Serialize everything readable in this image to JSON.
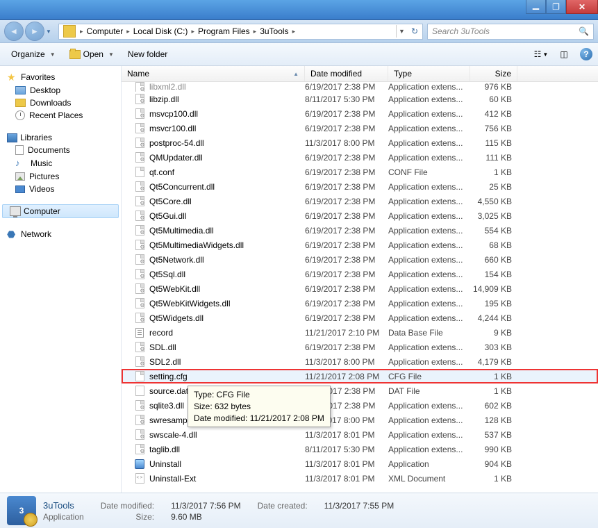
{
  "window": {
    "min": "_",
    "max": "❐",
    "close": "✕"
  },
  "breadcrumb": {
    "segments": [
      "Computer",
      "Local Disk (C:)",
      "Program Files",
      "3uTools"
    ]
  },
  "search": {
    "placeholder": "Search 3uTools"
  },
  "toolbar": {
    "organize": "Organize",
    "open": "Open",
    "newfolder": "New folder"
  },
  "columns": {
    "name": "Name",
    "date": "Date modified",
    "type": "Type",
    "size": "Size"
  },
  "sidebar": {
    "favorites": {
      "label": "Favorites",
      "items": [
        "Desktop",
        "Downloads",
        "Recent Places"
      ]
    },
    "libraries": {
      "label": "Libraries",
      "items": [
        "Documents",
        "Music",
        "Pictures",
        "Videos"
      ]
    },
    "computer": {
      "label": "Computer"
    },
    "network": {
      "label": "Network"
    }
  },
  "files": [
    {
      "name": "libxml2.dll",
      "date": "6/19/2017 2:38 PM",
      "type": "Application extens...",
      "size": "976 KB",
      "icon": "dll",
      "partial": true
    },
    {
      "name": "libzip.dll",
      "date": "8/11/2017 5:30 PM",
      "type": "Application extens...",
      "size": "60 KB",
      "icon": "dll"
    },
    {
      "name": "msvcp100.dll",
      "date": "6/19/2017 2:38 PM",
      "type": "Application extens...",
      "size": "412 KB",
      "icon": "dll"
    },
    {
      "name": "msvcr100.dll",
      "date": "6/19/2017 2:38 PM",
      "type": "Application extens...",
      "size": "756 KB",
      "icon": "dll"
    },
    {
      "name": "postproc-54.dll",
      "date": "11/3/2017 8:00 PM",
      "type": "Application extens...",
      "size": "115 KB",
      "icon": "dll"
    },
    {
      "name": "QMUpdater.dll",
      "date": "6/19/2017 2:38 PM",
      "type": "Application extens...",
      "size": "111 KB",
      "icon": "dll"
    },
    {
      "name": "qt.conf",
      "date": "6/19/2017 2:38 PM",
      "type": "CONF File",
      "size": "1 KB",
      "icon": "cfg"
    },
    {
      "name": "Qt5Concurrent.dll",
      "date": "6/19/2017 2:38 PM",
      "type": "Application extens...",
      "size": "25 KB",
      "icon": "dll"
    },
    {
      "name": "Qt5Core.dll",
      "date": "6/19/2017 2:38 PM",
      "type": "Application extens...",
      "size": "4,550 KB",
      "icon": "dll"
    },
    {
      "name": "Qt5Gui.dll",
      "date": "6/19/2017 2:38 PM",
      "type": "Application extens...",
      "size": "3,025 KB",
      "icon": "dll"
    },
    {
      "name": "Qt5Multimedia.dll",
      "date": "6/19/2017 2:38 PM",
      "type": "Application extens...",
      "size": "554 KB",
      "icon": "dll"
    },
    {
      "name": "Qt5MultimediaWidgets.dll",
      "date": "6/19/2017 2:38 PM",
      "type": "Application extens...",
      "size": "68 KB",
      "icon": "dll"
    },
    {
      "name": "Qt5Network.dll",
      "date": "6/19/2017 2:38 PM",
      "type": "Application extens...",
      "size": "660 KB",
      "icon": "dll"
    },
    {
      "name": "Qt5Sql.dll",
      "date": "6/19/2017 2:38 PM",
      "type": "Application extens...",
      "size": "154 KB",
      "icon": "dll"
    },
    {
      "name": "Qt5WebKit.dll",
      "date": "6/19/2017 2:38 PM",
      "type": "Application extens...",
      "size": "14,909 KB",
      "icon": "dll"
    },
    {
      "name": "Qt5WebKitWidgets.dll",
      "date": "6/19/2017 2:38 PM",
      "type": "Application extens...",
      "size": "195 KB",
      "icon": "dll"
    },
    {
      "name": "Qt5Widgets.dll",
      "date": "6/19/2017 2:38 PM",
      "type": "Application extens...",
      "size": "4,244 KB",
      "icon": "dll"
    },
    {
      "name": "record",
      "date": "11/21/2017 2:10 PM",
      "type": "Data Base File",
      "size": "9 KB",
      "icon": "db"
    },
    {
      "name": "SDL.dll",
      "date": "6/19/2017 2:38 PM",
      "type": "Application extens...",
      "size": "303 KB",
      "icon": "dll"
    },
    {
      "name": "SDL2.dll",
      "date": "11/3/2017 8:00 PM",
      "type": "Application extens...",
      "size": "4,179 KB",
      "icon": "dll"
    },
    {
      "name": "setting.cfg",
      "date": "11/21/2017 2:08 PM",
      "type": "CFG File",
      "size": "1 KB",
      "icon": "cfg",
      "highlight": true
    },
    {
      "name": "source.dat",
      "date": "6/19/2017 2:38 PM",
      "type": "DAT File",
      "size": "1 KB",
      "icon": "dat",
      "obscured_date": "9/2017 2:38 PM"
    },
    {
      "name": "sqlite3.dll",
      "date": "6/19/2017 2:38 PM",
      "type": "Application extens...",
      "size": "602 KB",
      "icon": "dll",
      "obscured_date": "9/2017 2:38 PM"
    },
    {
      "name": "swresample-2.dll",
      "date": "11/3/2017 8:00 PM",
      "type": "Application extens...",
      "size": "128 KB",
      "icon": "dll",
      "obscured_date": "3/2017 8:00 PM"
    },
    {
      "name": "swscale-4.dll",
      "date": "11/3/2017 8:01 PM",
      "type": "Application extens...",
      "size": "537 KB",
      "icon": "dll"
    },
    {
      "name": "taglib.dll",
      "date": "8/11/2017 5:30 PM",
      "type": "Application extens...",
      "size": "990 KB",
      "icon": "dll"
    },
    {
      "name": "Uninstall",
      "date": "11/3/2017 8:01 PM",
      "type": "Application",
      "size": "904 KB",
      "icon": "app"
    },
    {
      "name": "Uninstall-Ext",
      "date": "11/3/2017 8:01 PM",
      "type": "XML Document",
      "size": "1 KB",
      "icon": "xml"
    }
  ],
  "tooltip": {
    "line1": "Type: CFG File",
    "line2": "Size: 632 bytes",
    "line3": "Date modified: 11/21/2017 2:08 PM"
  },
  "details": {
    "name": "3uTools",
    "sub": "Application",
    "mod_label": "Date modified:",
    "mod_val": "11/3/2017 7:56 PM",
    "size_label": "Size:",
    "size_val": "9.60 MB",
    "created_label": "Date created:",
    "created_val": "11/3/2017 7:55 PM",
    "icon_text": "3"
  }
}
